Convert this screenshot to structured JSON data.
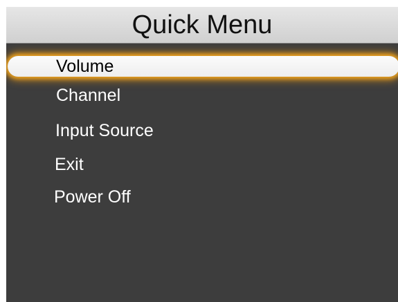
{
  "window": {
    "title": "Quick Menu"
  },
  "menu": {
    "items": [
      {
        "label": "Volume",
        "selected": true
      },
      {
        "label": "Channel",
        "selected": false
      },
      {
        "label": "Input Source",
        "selected": false
      },
      {
        "label": "Exit",
        "selected": false
      },
      {
        "label": "Power Off",
        "selected": false
      }
    ]
  },
  "colors": {
    "panel_background": "#3d3d3d",
    "title_bar": "#dcdcdc",
    "selection_glow": "#e8a020",
    "item_text": "#ffffff"
  }
}
